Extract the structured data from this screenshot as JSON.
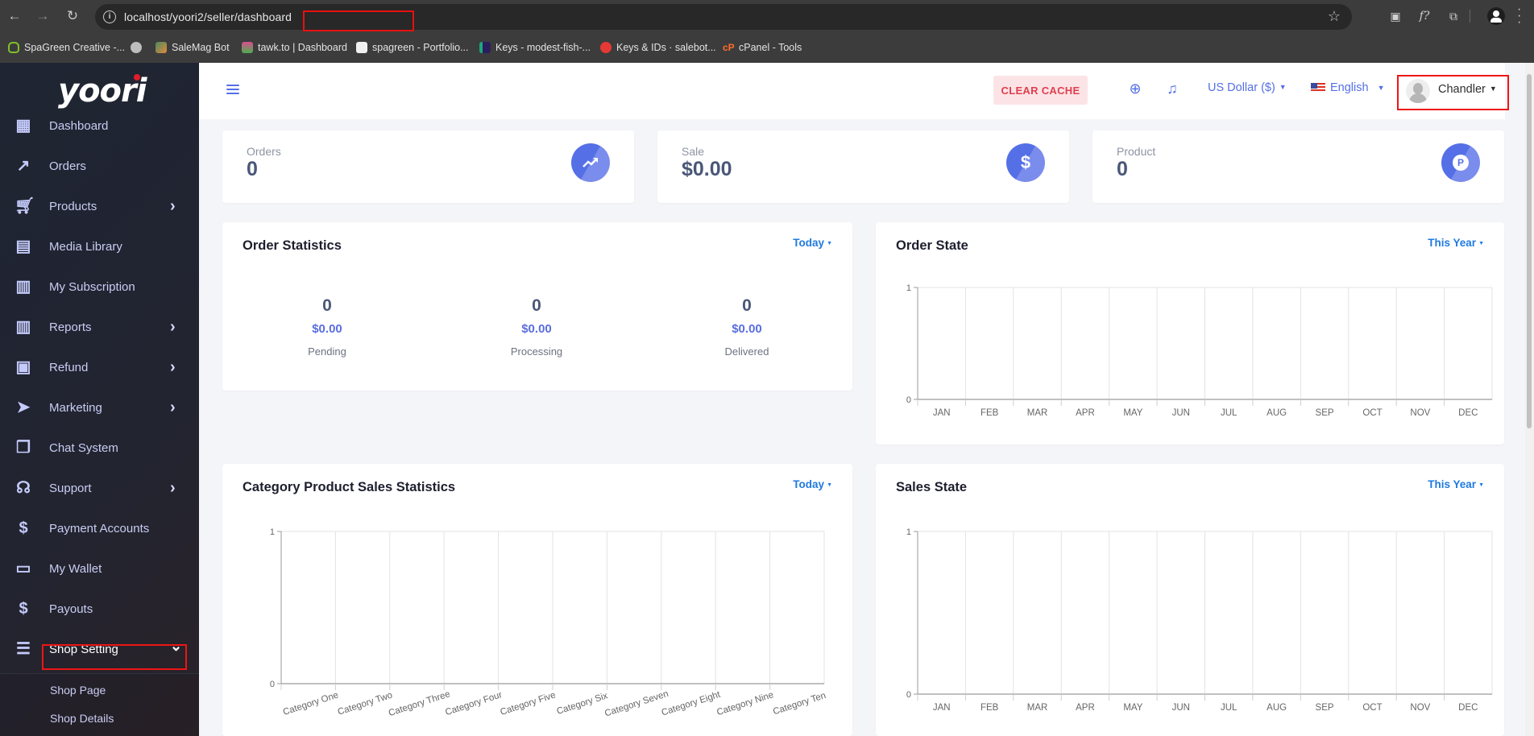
{
  "browser": {
    "url_host": "localhost/yoori2/",
    "url_path": "seller/dashboard",
    "bookmarks": [
      {
        "label": "SpaGreen Creative -...",
        "color": "#7fbf2a"
      },
      {
        "label": "",
        "color": "#bdbdbd"
      },
      {
        "label": "SaleMag Bot",
        "color": "#7a8d6a"
      },
      {
        "label": "tawk.to | Dashboard",
        "color": "#4caf50"
      },
      {
        "label": "spagreen - Portfolio...",
        "color": "#f0f0f0"
      },
      {
        "label": "Keys - modest-fish-...",
        "color": "#2b1d5c"
      },
      {
        "label": "Keys & IDs · salebot...",
        "color": "#e53935"
      },
      {
        "label": "cPanel - Tools",
        "color": "#ff6c2c"
      }
    ]
  },
  "sidebar": {
    "logo": "yoori",
    "items": [
      {
        "label": "Dashboard",
        "icon": "dashboard-icon",
        "glyph": "▦",
        "chevron": false
      },
      {
        "label": "Orders",
        "icon": "trending-up-icon",
        "glyph": "↗",
        "chevron": false
      },
      {
        "label": "Products",
        "icon": "cart-icon",
        "glyph": "🛒︎",
        "chevron": true
      },
      {
        "label": "Media Library",
        "icon": "document-icon",
        "glyph": "▤",
        "chevron": false
      },
      {
        "label": "My Subscription",
        "icon": "report-file-icon",
        "glyph": "▥",
        "chevron": false
      },
      {
        "label": "Reports",
        "icon": "report-file-icon",
        "glyph": "▥",
        "chevron": true
      },
      {
        "label": "Refund",
        "icon": "refund-icon",
        "glyph": "▣",
        "chevron": true
      },
      {
        "label": "Marketing",
        "icon": "send-icon",
        "glyph": "➤",
        "chevron": true
      },
      {
        "label": "Chat System",
        "icon": "chat-icon",
        "glyph": "❐",
        "chevron": false
      },
      {
        "label": "Support",
        "icon": "headset-icon",
        "glyph": "☊",
        "chevron": true
      },
      {
        "label": "Payment Accounts",
        "icon": "dollar-icon",
        "glyph": "$",
        "chevron": false
      },
      {
        "label": "My Wallet",
        "icon": "wallet-icon",
        "glyph": "▭",
        "chevron": false
      },
      {
        "label": "Payouts",
        "icon": "dollar-icon",
        "glyph": "$",
        "chevron": false
      },
      {
        "label": "Shop Setting",
        "icon": "sliders-icon",
        "glyph": "☰",
        "chevron": "down"
      }
    ],
    "submenu": [
      "Shop Page",
      "Shop Details"
    ]
  },
  "header": {
    "clear_cache": "CLEAR CACHE",
    "currency": "US Dollar ($)",
    "language": "English",
    "user": "Chandler"
  },
  "stats": [
    {
      "label": "Orders",
      "value": "0",
      "icon": "trending-up-icon"
    },
    {
      "label": "Sale",
      "value": "$0.00",
      "icon": "dollar-icon"
    },
    {
      "label": "Product",
      "value": "0",
      "icon": "product-icon"
    }
  ],
  "order_statistics": {
    "title": "Order Statistics",
    "filter": "Today",
    "columns": [
      {
        "count": "0",
        "amount": "$0.00",
        "label": "Pending"
      },
      {
        "count": "0",
        "amount": "$0.00",
        "label": "Processing"
      },
      {
        "count": "0",
        "amount": "$0.00",
        "label": "Delivered"
      }
    ]
  },
  "order_state": {
    "title": "Order State",
    "filter": "This Year"
  },
  "category_stats": {
    "title": "Category Product Sales Statistics",
    "filter": "Today"
  },
  "sales_state": {
    "title": "Sales State",
    "filter": "This Year"
  },
  "chart_data": [
    {
      "id": "order_state",
      "type": "bar",
      "title": "Order State",
      "categories": [
        "JAN",
        "FEB",
        "MAR",
        "APR",
        "MAY",
        "JUN",
        "JUL",
        "AUG",
        "SEP",
        "OCT",
        "NOV",
        "DEC"
      ],
      "values": [
        0,
        0,
        0,
        0,
        0,
        0,
        0,
        0,
        0,
        0,
        0,
        0
      ],
      "yticks": [
        "0",
        "1"
      ],
      "ylim": [
        0,
        1
      ],
      "xlabel": "",
      "ylabel": "",
      "grid": true
    },
    {
      "id": "category_stats",
      "type": "bar",
      "title": "Category Product Sales Statistics",
      "categories": [
        "Category One",
        "Category Two",
        "Category Three",
        "Category Four",
        "Category Five",
        "Category Six",
        "Category Seven",
        "Category Eight",
        "Category Nine",
        "Category Ten"
      ],
      "values": [
        0,
        0,
        0,
        0,
        0,
        0,
        0,
        0,
        0,
        0
      ],
      "yticks": [
        "0",
        "1"
      ],
      "ylim": [
        0,
        1
      ],
      "xlabel": "",
      "ylabel": "",
      "grid": true,
      "rotated_labels": true
    },
    {
      "id": "sales_state",
      "type": "bar",
      "title": "Sales State",
      "categories": [
        "JAN",
        "FEB",
        "MAR",
        "APR",
        "MAY",
        "JUN",
        "JUL",
        "AUG",
        "SEP",
        "OCT",
        "NOV",
        "DEC"
      ],
      "values": [
        0,
        0,
        0,
        0,
        0,
        0,
        0,
        0,
        0,
        0,
        0,
        0
      ],
      "yticks": [
        "0",
        "1"
      ],
      "ylim": [
        0,
        1
      ],
      "xlabel": "",
      "ylabel": "",
      "grid": true
    }
  ]
}
